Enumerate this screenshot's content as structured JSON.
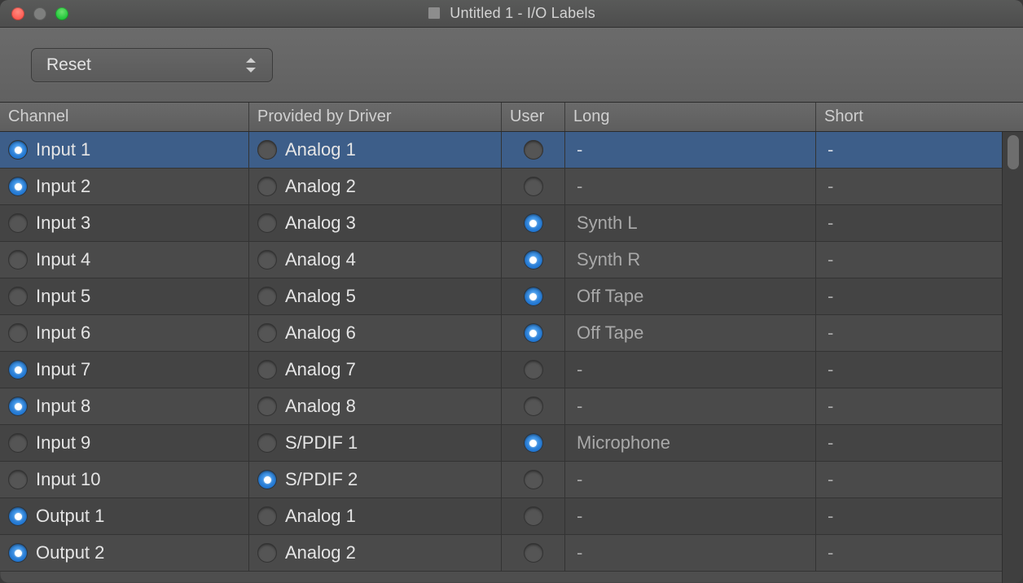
{
  "window": {
    "title": "Untitled 1 - I/O Labels"
  },
  "toolbar": {
    "reset_label": "Reset"
  },
  "columns": {
    "channel": "Channel",
    "driver": "Provided by Driver",
    "user": "User",
    "long": "Long",
    "short": "Short"
  },
  "rows": [
    {
      "channel": "Input 1",
      "ch_radio": true,
      "driver": "Analog 1",
      "drv_radio": false,
      "user_radio": false,
      "long": "-",
      "short": "-",
      "selected": true
    },
    {
      "channel": "Input 2",
      "ch_radio": true,
      "driver": "Analog 2",
      "drv_radio": false,
      "user_radio": false,
      "long": "-",
      "short": "-",
      "selected": false
    },
    {
      "channel": "Input 3",
      "ch_radio": false,
      "driver": "Analog 3",
      "drv_radio": false,
      "user_radio": true,
      "long": "Synth L",
      "short": "-",
      "selected": false
    },
    {
      "channel": "Input 4",
      "ch_radio": false,
      "driver": "Analog 4",
      "drv_radio": false,
      "user_radio": true,
      "long": "Synth R",
      "short": "-",
      "selected": false
    },
    {
      "channel": "Input 5",
      "ch_radio": false,
      "driver": "Analog 5",
      "drv_radio": false,
      "user_radio": true,
      "long": "Off Tape",
      "short": "-",
      "selected": false
    },
    {
      "channel": "Input 6",
      "ch_radio": false,
      "driver": "Analog 6",
      "drv_radio": false,
      "user_radio": true,
      "long": "Off Tape",
      "short": "-",
      "selected": false
    },
    {
      "channel": "Input 7",
      "ch_radio": true,
      "driver": "Analog 7",
      "drv_radio": false,
      "user_radio": false,
      "long": "-",
      "short": "-",
      "selected": false
    },
    {
      "channel": "Input 8",
      "ch_radio": true,
      "driver": "Analog 8",
      "drv_radio": false,
      "user_radio": false,
      "long": "-",
      "short": "-",
      "selected": false
    },
    {
      "channel": "Input 9",
      "ch_radio": false,
      "driver": "S/PDIF 1",
      "drv_radio": false,
      "user_radio": true,
      "long": "Microphone",
      "short": "-",
      "selected": false
    },
    {
      "channel": "Input 10",
      "ch_radio": false,
      "driver": "S/PDIF 2",
      "drv_radio": true,
      "user_radio": false,
      "long": "-",
      "short": "-",
      "selected": false
    },
    {
      "channel": "Output 1",
      "ch_radio": true,
      "driver": "Analog 1",
      "drv_radio": false,
      "user_radio": false,
      "long": "-",
      "short": "-",
      "selected": false
    },
    {
      "channel": "Output 2",
      "ch_radio": true,
      "driver": "Analog 2",
      "drv_radio": false,
      "user_radio": false,
      "long": "-",
      "short": "-",
      "selected": false
    }
  ]
}
